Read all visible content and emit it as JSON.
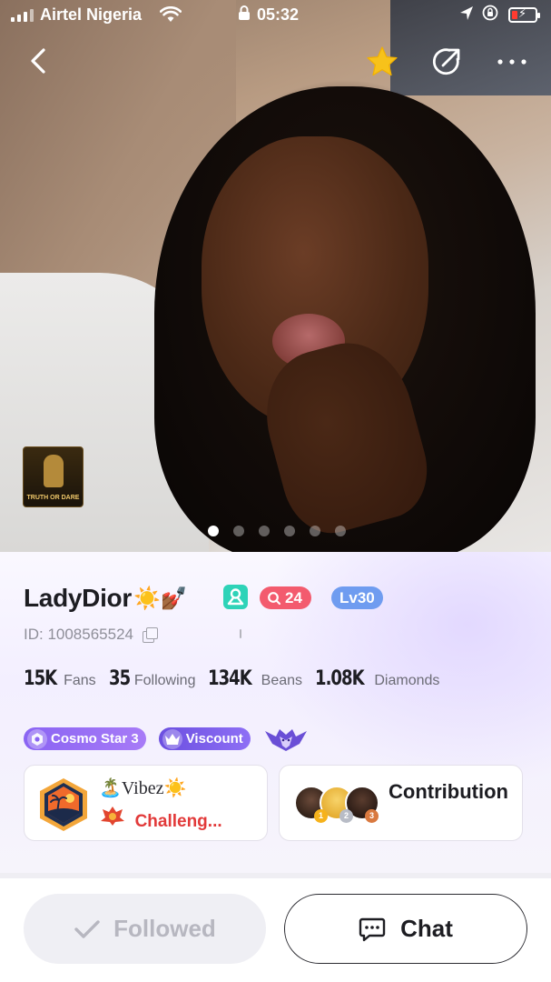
{
  "status_bar": {
    "carrier": "Airtel Nigeria",
    "time": "05:32"
  },
  "hero": {
    "thumbnail_title": "TRUTH OR DARE",
    "photo_count": 6,
    "active_photo": 1
  },
  "profile": {
    "username": "LadyDior",
    "name_emojis": "☀️💅🏾",
    "rank_value": "24",
    "level": "Lv30",
    "id_text": "ID: 1008565524"
  },
  "stats": [
    {
      "value": "15K",
      "label": "Fans"
    },
    {
      "value": "35",
      "label": "Following"
    },
    {
      "value": "134K",
      "label": "Beans"
    },
    {
      "value": "1.08K",
      "label": "Diamonds"
    }
  ],
  "medals": {
    "cosmo": "Cosmo Star 3",
    "viscount": "Viscount"
  },
  "family_card": {
    "title": "🏝️Vibez☀️",
    "subtitle": "Challeng..."
  },
  "contribution_card": {
    "label": "Contribution",
    "ranks": [
      "1",
      "2",
      "3"
    ]
  },
  "actions": {
    "followed": "Followed",
    "chat": "Chat"
  },
  "colors": {
    "gender_badge": "#2ed3b8",
    "rank_badge": "#f35b6e",
    "level_badge": "#6f9cf0",
    "medal_purple": "#8a64f3",
    "family_subtitle": "#e23a3a"
  }
}
